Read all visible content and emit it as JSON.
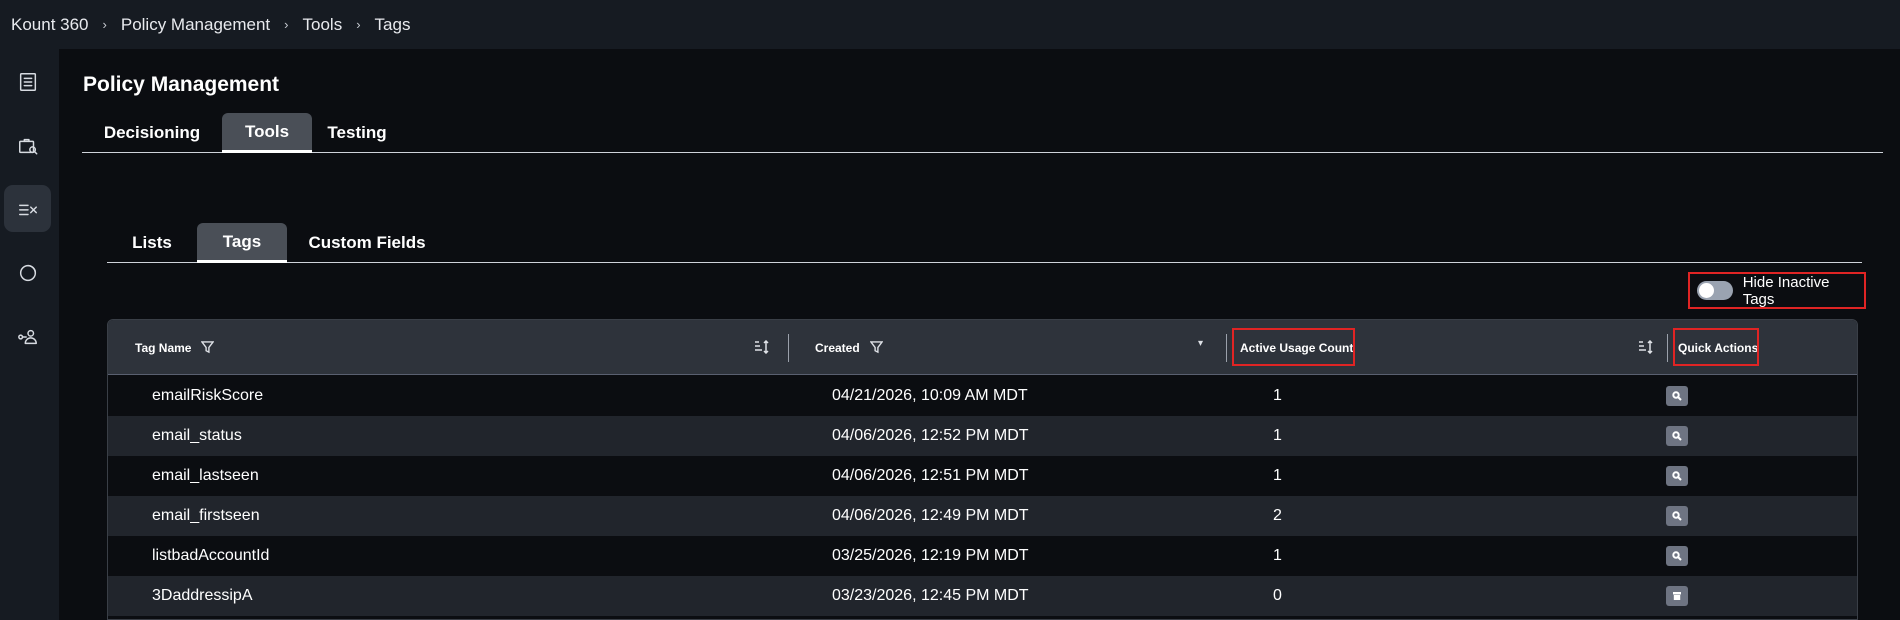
{
  "breadcrumb": [
    "Kount 360",
    "Policy Management",
    "Tools",
    "Tags"
  ],
  "page_title": "Policy Management",
  "main_tabs": [
    {
      "label": "Decisioning",
      "active": false
    },
    {
      "label": "Tools",
      "active": true
    },
    {
      "label": "Testing",
      "active": false
    }
  ],
  "sub_tabs": [
    {
      "label": "Lists",
      "active": false
    },
    {
      "label": "Tags",
      "active": true
    },
    {
      "label": "Custom Fields",
      "active": false
    }
  ],
  "rail_icons": [
    "list-icon",
    "briefcase-search-icon",
    "rules-icon",
    "donut-chart-icon",
    "user-network-icon"
  ],
  "toggle": {
    "label": "Hide Inactive Tags",
    "on": false
  },
  "table": {
    "columns": [
      "Tag Name",
      "Created",
      "Active Usage Count",
      "Quick Actions"
    ],
    "rows": [
      {
        "name": "emailRiskScore",
        "created": "04/21/2026, 10:09 AM MDT",
        "count": "1",
        "action": "view"
      },
      {
        "name": "email_status",
        "created": "04/06/2026, 12:52 PM MDT",
        "count": "1",
        "action": "view"
      },
      {
        "name": "email_lastseen",
        "created": "04/06/2026, 12:51 PM MDT",
        "count": "1",
        "action": "view"
      },
      {
        "name": "email_firstseen",
        "created": "04/06/2026, 12:49 PM MDT",
        "count": "2",
        "action": "view"
      },
      {
        "name": "listbadAccountId",
        "created": "03/25/2026, 12:19 PM MDT",
        "count": "1",
        "action": "view"
      },
      {
        "name": "3DaddressipA",
        "created": "03/23/2026, 12:45 PM MDT",
        "count": "0",
        "action": "archive"
      }
    ]
  },
  "colors": {
    "highlight": "#e02424",
    "header_bg": "#2e333b",
    "alt_row": "#21252c"
  }
}
